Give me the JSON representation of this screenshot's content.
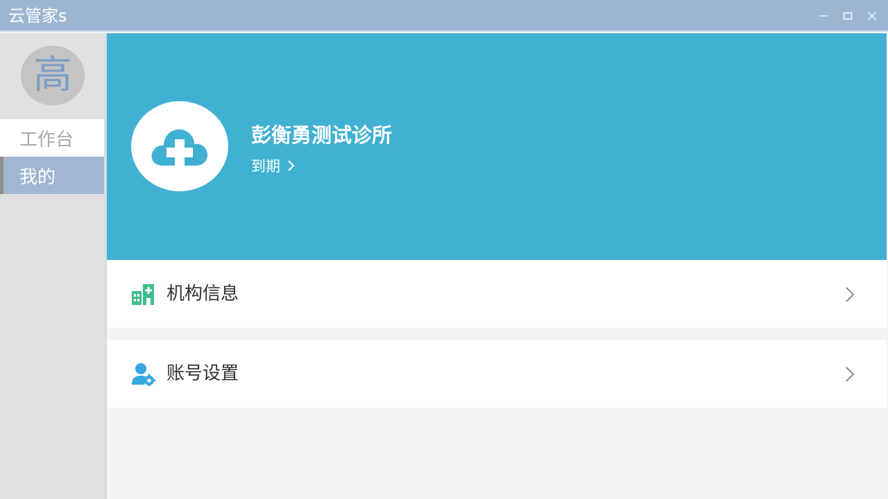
{
  "window": {
    "title": "云管家s",
    "controls": [
      "minimize-icon",
      "maximize-icon",
      "close-icon"
    ]
  },
  "sidebar": {
    "avatar_text": "高",
    "items": [
      {
        "label": "工作台",
        "active": false
      },
      {
        "label": "我的",
        "active": true
      }
    ]
  },
  "profile": {
    "clinic_name": "彭衡勇测试诊所",
    "expire_label": "到期",
    "logo_icon": "cloud-plus-icon"
  },
  "menu": [
    {
      "label": "机构信息",
      "icon": "building-icon"
    },
    {
      "label": "账号设置",
      "icon": "user-gear-icon"
    }
  ],
  "colors": {
    "titlebar": "#9cb6d2",
    "banner": "#41b1d3",
    "sidebar_active": "#a0b6d2",
    "org_icon": "#3dbf8a",
    "account_icon": "#35a7df"
  }
}
